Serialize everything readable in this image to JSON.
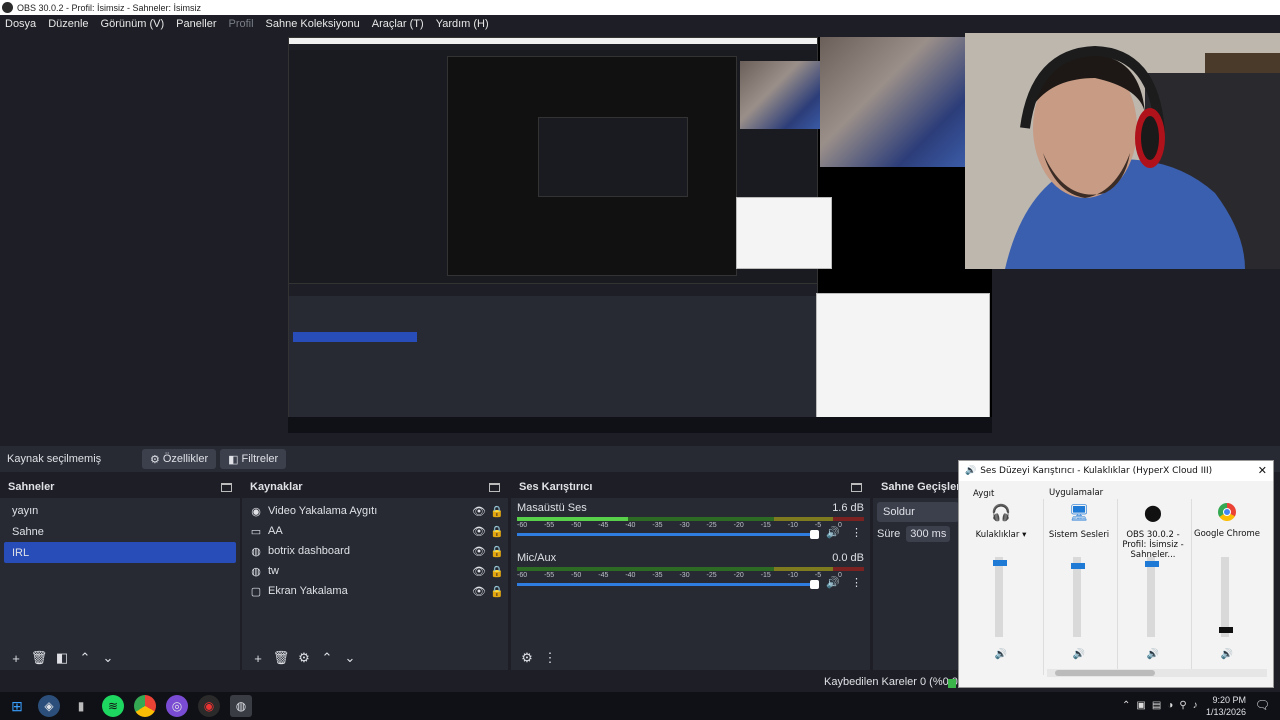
{
  "window": {
    "title": "OBS 30.0.2 - Profil: İsimsiz - Sahneler: İsimsiz"
  },
  "menu": [
    "Dosya",
    "Düzenle",
    "Görünüm (V)",
    "Paneller",
    "Profil",
    "Sahne Koleksiyonu",
    "Araçlar (T)",
    "Yardım (H)"
  ],
  "source_bar": {
    "no_source": "Kaynak seçilmemiş",
    "properties": "Özellikler",
    "filters": "Filtreler"
  },
  "scenes": {
    "title": "Sahneler",
    "items": [
      "yayın",
      "Sahne",
      "IRL"
    ],
    "selected": "IRL"
  },
  "sources": {
    "title": "Kaynaklar",
    "items": [
      {
        "label": "Video Yakalama Aygıtı",
        "icon": "camera-icon"
      },
      {
        "label": "AA",
        "icon": "window-icon"
      },
      {
        "label": "botrix dashboard",
        "icon": "globe-icon"
      },
      {
        "label": "tw",
        "icon": "globe-icon"
      },
      {
        "label": "Ekran Yakalama",
        "icon": "monitor-icon"
      }
    ]
  },
  "mixer": {
    "title": "Ses Karıştırıcı",
    "ticks": [
      "-60",
      "-55",
      "-50",
      "-45",
      "-40",
      "-35",
      "-30",
      "-25",
      "-20",
      "-15",
      "-10",
      "-5",
      "0"
    ],
    "channels": [
      {
        "name": "Masaüstü Ses",
        "db": "1.6 dB",
        "level": 0.32
      },
      {
        "name": "Mic/Aux",
        "db": "0.0 dB",
        "level": 0.0
      }
    ]
  },
  "transitions": {
    "title": "Sahne Geçişleri",
    "type": "Soldur",
    "duration_label": "Süre",
    "duration": "300 ms"
  },
  "status": {
    "dropped": "Kaybedilen Kareler 0 (%0.0)"
  },
  "volume_mixer": {
    "title": "Ses Düzeyi Karıştırıcı - Kulaklıklar (HyperX Cloud III)",
    "device_label": "Aygıt",
    "apps_label": "Uygulamalar",
    "device_name": "Kulaklıklar",
    "apps": [
      {
        "name": "Sistem Sesleri",
        "level": 0.92
      },
      {
        "name": "OBS 30.0.2 - Profil: İsimsiz - Sahneler...",
        "level": 0.95
      },
      {
        "name": "Google Chrome",
        "level": 0.05
      }
    ],
    "device_level": 0.96
  },
  "clock": {
    "time": "9:20 PM",
    "date": "1/13/2026"
  },
  "colors": {
    "accent": "#284cb8",
    "fader": "#2f7de0",
    "win_accent": "#1f7ad6"
  }
}
